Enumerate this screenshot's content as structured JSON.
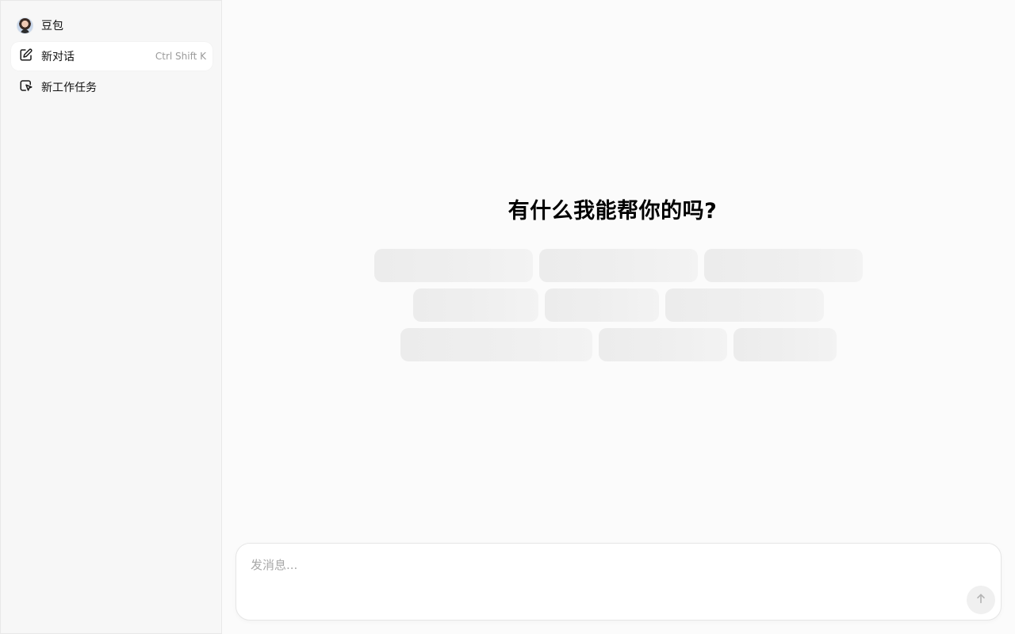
{
  "sidebar": {
    "brand": {
      "name": "豆包",
      "avatar_icon": "avatar"
    },
    "items": [
      {
        "label": "新对话",
        "shortcut": "Ctrl Shift K",
        "icon": "edit-icon",
        "active": true
      },
      {
        "label": "新工作任务",
        "icon": "task-pointer-icon",
        "active": false
      }
    ]
  },
  "main": {
    "headline": "有什么我能帮你的吗?",
    "suggestion_placeholders": 9
  },
  "composer": {
    "placeholder": "发消息...",
    "value": "",
    "send_icon": "arrow-up-icon"
  },
  "colors": {
    "page_bg": "#fbfbfb",
    "sidebar_bg": "#f7f7f7",
    "active_item_bg": "#ffffff",
    "skeleton": "#ededed",
    "send_button_bg": "#f0f0f0"
  }
}
